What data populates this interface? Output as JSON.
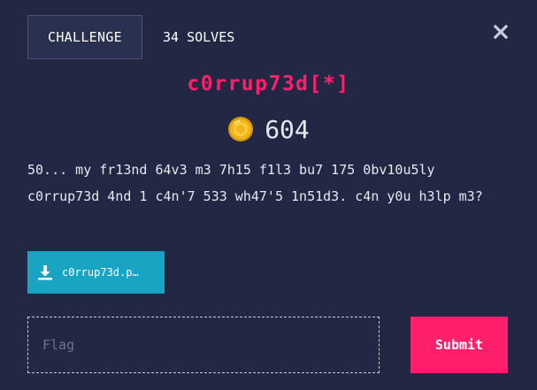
{
  "tabs": {
    "challenge_label": "CHALLENGE",
    "solves_label": "34 SOLVES"
  },
  "challenge": {
    "title": "c0rrup73d[*]",
    "points": "604",
    "description": "50... my fr13nd 64v3 m3 7h15 f1l3 bu7 175 0bv10u5ly c0rrup73d 4nd 1 c4n'7 533 wh47'5 1n51d3. c4n y0u h3lp m3?"
  },
  "file": {
    "label": "c0rrup73d.p…"
  },
  "flag_input": {
    "placeholder": "Flag",
    "value": ""
  },
  "submit": {
    "label": "Submit"
  },
  "icons": {
    "close": "close-icon",
    "coin": "coin-icon",
    "download": "download-icon"
  },
  "colors": {
    "background": "#222844",
    "accent": "#ff1f6b",
    "download": "#18a4c2",
    "coin": "#f2b51d"
  }
}
